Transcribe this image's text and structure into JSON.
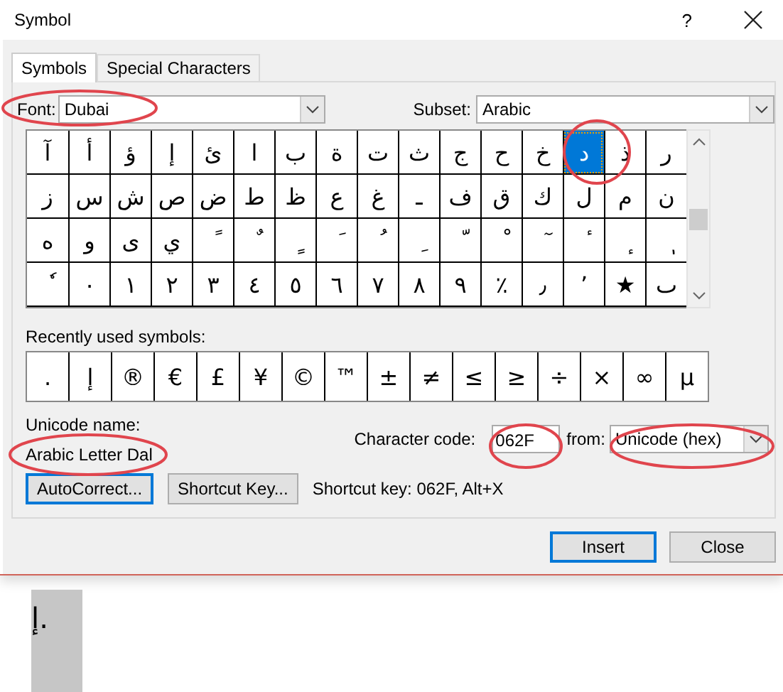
{
  "window": {
    "title": "Symbol",
    "help": "?"
  },
  "tabs": [
    {
      "label": "Symbols",
      "selected": true
    },
    {
      "label": "Special Characters",
      "selected": false
    }
  ],
  "font_field": {
    "label": "Font:",
    "value": "Dubai"
  },
  "subset_field": {
    "label": "Subset:",
    "value": "Arabic"
  },
  "symbol_grid": [
    {
      "cells": [
        {
          "char": "ر",
          "selected": false
        },
        {
          "char": "ذ",
          "selected": false
        },
        {
          "char": "د",
          "selected": true
        },
        {
          "char": "خ",
          "selected": false
        },
        {
          "char": "ح",
          "selected": false
        },
        {
          "char": "ج",
          "selected": false
        },
        {
          "char": "ث",
          "selected": false
        },
        {
          "char": "ت",
          "selected": false
        },
        {
          "char": "ة",
          "selected": false
        },
        {
          "char": "ب",
          "selected": false
        },
        {
          "char": "ا",
          "selected": false
        },
        {
          "char": "ئ",
          "selected": false
        },
        {
          "char": "إ",
          "selected": false
        },
        {
          "char": "ؤ",
          "selected": false
        },
        {
          "char": "أ",
          "selected": false
        },
        {
          "char": "آ",
          "selected": false
        }
      ]
    },
    {
      "cells": [
        {
          "char": "ن",
          "selected": false
        },
        {
          "char": "م",
          "selected": false
        },
        {
          "char": "ل",
          "selected": false
        },
        {
          "char": "ك",
          "selected": false
        },
        {
          "char": "ق",
          "selected": false
        },
        {
          "char": "ف",
          "selected": false
        },
        {
          "char": "ـ",
          "selected": false
        },
        {
          "char": "غ",
          "selected": false
        },
        {
          "char": "ع",
          "selected": false
        },
        {
          "char": "ظ",
          "selected": false
        },
        {
          "char": "ط",
          "selected": false
        },
        {
          "char": "ض",
          "selected": false
        },
        {
          "char": "ص",
          "selected": false
        },
        {
          "char": "ش",
          "selected": false
        },
        {
          "char": "س",
          "selected": false
        },
        {
          "char": "ز",
          "selected": false
        }
      ]
    },
    {
      "cells": [
        {
          "char": "ٖ",
          "selected": false
        },
        {
          "char": "ٕ",
          "selected": false
        },
        {
          "char": "ٔ",
          "selected": false
        },
        {
          "char": "ٓ",
          "selected": false
        },
        {
          "char": "ْ",
          "selected": false
        },
        {
          "char": "ّ",
          "selected": false
        },
        {
          "char": "ِ",
          "selected": false
        },
        {
          "char": "ُ",
          "selected": false
        },
        {
          "char": "َ",
          "selected": false
        },
        {
          "char": "ٍ",
          "selected": false
        },
        {
          "char": "ٌ",
          "selected": false
        },
        {
          "char": "ً",
          "selected": false
        },
        {
          "char": "ي",
          "selected": false
        },
        {
          "char": "ى",
          "selected": false
        },
        {
          "char": "و",
          "selected": false
        },
        {
          "char": "ه",
          "selected": false
        }
      ]
    },
    {
      "cells": [
        {
          "char": "ٮ",
          "selected": false
        },
        {
          "char": "★",
          "selected": false
        },
        {
          "char": "٬",
          "selected": false
        },
        {
          "char": "٫",
          "selected": false
        },
        {
          "char": "٪",
          "selected": false
        },
        {
          "char": "٩",
          "selected": false
        },
        {
          "char": "٨",
          "selected": false
        },
        {
          "char": "٧",
          "selected": false
        },
        {
          "char": "٦",
          "selected": false
        },
        {
          "char": "٥",
          "selected": false
        },
        {
          "char": "٤",
          "selected": false
        },
        {
          "char": "٣",
          "selected": false
        },
        {
          "char": "٢",
          "selected": false
        },
        {
          "char": "١",
          "selected": false
        },
        {
          "char": "٠",
          "selected": false
        },
        {
          "char": "ٗ",
          "selected": false
        }
      ]
    }
  ],
  "recently_used": {
    "label": "Recently used symbols:",
    "symbols": [
      ".",
      "إ",
      "®",
      "€",
      "£",
      "¥",
      "©",
      "™",
      "±",
      "≠",
      "≤",
      "≥",
      "÷",
      "×",
      "∞",
      "µ"
    ]
  },
  "unicode_name": {
    "label": "Unicode name:",
    "value": "Arabic Letter Dal"
  },
  "character_code": {
    "label": "Character code:",
    "value": "062F"
  },
  "from_field": {
    "label": "from:",
    "value": "Unicode (hex)"
  },
  "action_buttons": [
    {
      "label": "AutoCorrect...",
      "focused": true
    },
    {
      "label": "Shortcut Key...",
      "focused": false
    }
  ],
  "shortcut_text": "Shortcut key: 062F, Alt+X",
  "footer_buttons": [
    {
      "label": "Insert",
      "focused": true
    },
    {
      "label": "Close",
      "focused": false
    }
  ],
  "document": {
    "text": "إ."
  }
}
